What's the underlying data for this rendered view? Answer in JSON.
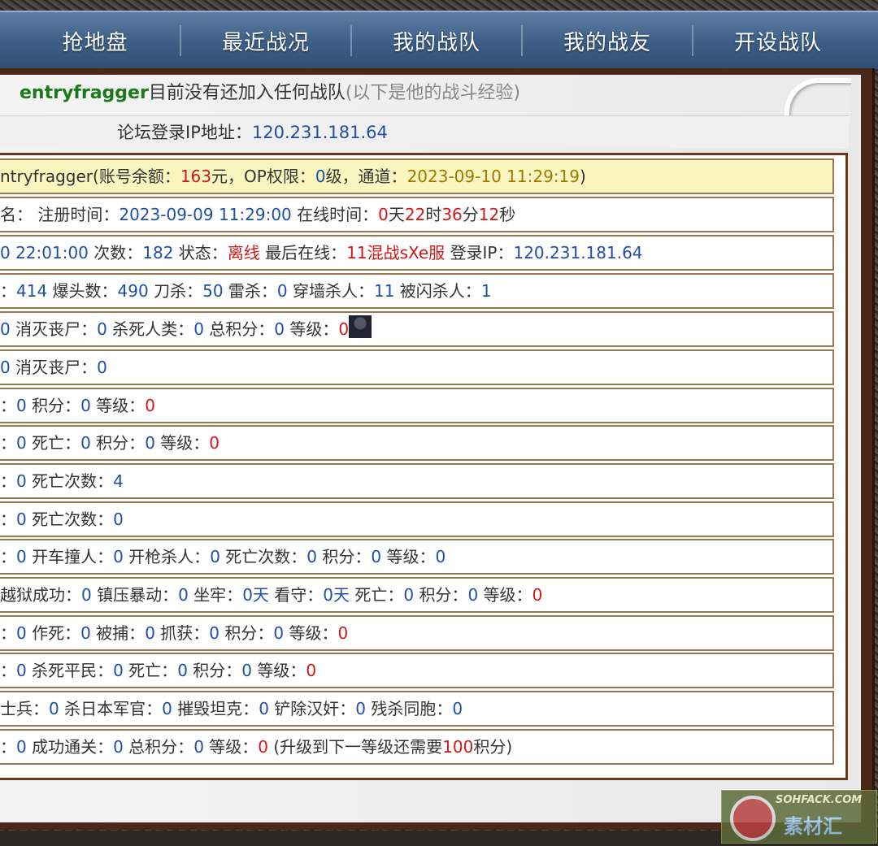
{
  "nav": {
    "items": [
      "抢地盘",
      "最近战况",
      "我的战队",
      "我的战友",
      "开设战队"
    ]
  },
  "header": {
    "username": "entryfragger",
    "no_team_text": "目前没有还加入任何战队",
    "note": "(以下是他的战斗经验)"
  },
  "ip_line": {
    "label": "论坛登录IP地址：",
    "value": "120.231.181.64"
  },
  "rows": [
    {
      "parts": [
        [
          "ntryfragger(账号余额：",
          ""
        ],
        [
          "163",
          "red"
        ],
        [
          "元，OP权限：",
          ""
        ],
        [
          "0",
          "blue"
        ],
        [
          "级，通道：",
          ""
        ],
        [
          "2023-09-10 11:29:19",
          "gold"
        ],
        [
          ")",
          ""
        ]
      ]
    },
    {
      "parts": [
        [
          "名： 注册时间：",
          ""
        ],
        [
          "2023-09-09 11:29:00",
          "blue"
        ],
        [
          " 在线时间：",
          ""
        ],
        [
          "0",
          "red"
        ],
        [
          "天",
          ""
        ],
        [
          "22",
          "red"
        ],
        [
          "时",
          ""
        ],
        [
          "36",
          "red"
        ],
        [
          "分",
          ""
        ],
        [
          "12",
          "red"
        ],
        [
          "秒",
          ""
        ]
      ]
    },
    {
      "parts": [
        [
          "0 22:01:00",
          "blue"
        ],
        [
          " 次数：",
          ""
        ],
        [
          "182",
          "blue"
        ],
        [
          " 状态：",
          ""
        ],
        [
          "离线",
          "red"
        ],
        [
          " 最后在线：",
          ""
        ],
        [
          "11混战sXe服",
          "red"
        ],
        [
          " 登录IP：",
          ""
        ],
        [
          "120.231.181.64",
          "blue"
        ]
      ]
    },
    {
      "parts": [
        [
          "：",
          ""
        ],
        [
          "414",
          "blue"
        ],
        [
          " 爆头数：",
          ""
        ],
        [
          "490",
          "blue"
        ],
        [
          " 刀杀：",
          ""
        ],
        [
          "50",
          "blue"
        ],
        [
          " 雷杀：",
          ""
        ],
        [
          "0",
          "blue"
        ],
        [
          " 穿墙杀人：",
          ""
        ],
        [
          "11",
          "blue"
        ],
        [
          " 被闪杀人：",
          ""
        ],
        [
          "1",
          "blue"
        ]
      ]
    },
    {
      "parts": [
        [
          "0",
          "blue"
        ],
        [
          " 消灭丧尸：",
          ""
        ],
        [
          "0",
          "blue"
        ],
        [
          " 杀死人类：",
          ""
        ],
        [
          "0",
          "blue"
        ],
        [
          " 总积分：",
          ""
        ],
        [
          "0",
          "blue"
        ],
        [
          " 等级：",
          ""
        ],
        [
          "0",
          "red"
        ]
      ],
      "avatar": true
    },
    {
      "parts": [
        [
          "0",
          "blue"
        ],
        [
          " 消灭丧尸：",
          ""
        ],
        [
          "0",
          "blue"
        ]
      ]
    },
    {
      "parts": [
        [
          "：",
          ""
        ],
        [
          "0",
          "blue"
        ],
        [
          " 积分：",
          ""
        ],
        [
          "0",
          "blue"
        ],
        [
          " 等级：",
          ""
        ],
        [
          "0",
          "red"
        ]
      ]
    },
    {
      "parts": [
        [
          "：",
          ""
        ],
        [
          "0",
          "blue"
        ],
        [
          " 死亡：",
          ""
        ],
        [
          "0",
          "blue"
        ],
        [
          " 积分：",
          ""
        ],
        [
          "0",
          "blue"
        ],
        [
          " 等级：",
          ""
        ],
        [
          "0",
          "red"
        ]
      ]
    },
    {
      "parts": [
        [
          "：",
          ""
        ],
        [
          "0",
          "blue"
        ],
        [
          " 死亡次数：",
          ""
        ],
        [
          "4",
          "blue"
        ]
      ]
    },
    {
      "parts": [
        [
          "：",
          ""
        ],
        [
          "0",
          "blue"
        ],
        [
          " 死亡次数：",
          ""
        ],
        [
          "0",
          "blue"
        ]
      ]
    },
    {
      "parts": [
        [
          "：",
          ""
        ],
        [
          "0",
          "blue"
        ],
        [
          " 开车撞人：",
          ""
        ],
        [
          "0",
          "blue"
        ],
        [
          " 开枪杀人：",
          ""
        ],
        [
          "0",
          "blue"
        ],
        [
          " 死亡次数：",
          ""
        ],
        [
          "0",
          "blue"
        ],
        [
          " 积分：",
          ""
        ],
        [
          "0",
          "blue"
        ],
        [
          " 等级：",
          ""
        ],
        [
          "0",
          "blue"
        ]
      ]
    },
    {
      "parts": [
        [
          "越狱成功：",
          ""
        ],
        [
          "0",
          "blue"
        ],
        [
          " 镇压暴动：",
          ""
        ],
        [
          "0",
          "blue"
        ],
        [
          " 坐牢：",
          ""
        ],
        [
          "0天",
          "blue"
        ],
        [
          " 看守：",
          ""
        ],
        [
          "0天",
          "blue"
        ],
        [
          " 死亡：",
          ""
        ],
        [
          "0",
          "blue"
        ],
        [
          " 积分：",
          ""
        ],
        [
          "0",
          "blue"
        ],
        [
          " 等级：",
          ""
        ],
        [
          "0",
          "red"
        ]
      ]
    },
    {
      "parts": [
        [
          "：",
          ""
        ],
        [
          "0",
          "blue"
        ],
        [
          " 作死：",
          ""
        ],
        [
          "0",
          "blue"
        ],
        [
          " 被捕：",
          ""
        ],
        [
          "0",
          "blue"
        ],
        [
          " 抓获：",
          ""
        ],
        [
          "0",
          "blue"
        ],
        [
          " 积分：",
          ""
        ],
        [
          "0",
          "blue"
        ],
        [
          " 等级：",
          ""
        ],
        [
          "0",
          "red"
        ]
      ]
    },
    {
      "parts": [
        [
          "：",
          ""
        ],
        [
          "0",
          "blue"
        ],
        [
          " 杀死平民：",
          ""
        ],
        [
          "0",
          "blue"
        ],
        [
          " 死亡：",
          ""
        ],
        [
          "0",
          "blue"
        ],
        [
          " 积分：",
          ""
        ],
        [
          "0",
          "blue"
        ],
        [
          " 等级：",
          ""
        ],
        [
          "0",
          "red"
        ]
      ]
    },
    {
      "parts": [
        [
          "士兵：",
          ""
        ],
        [
          "0",
          "blue"
        ],
        [
          " 杀日本军官：",
          ""
        ],
        [
          "0",
          "blue"
        ],
        [
          " 摧毁坦克：",
          ""
        ],
        [
          "0",
          "blue"
        ],
        [
          " 铲除汉奸：",
          ""
        ],
        [
          "0",
          "blue"
        ],
        [
          " 残杀同胞：",
          ""
        ],
        [
          "0",
          "blue"
        ]
      ]
    },
    {
      "parts": [
        [
          "：",
          ""
        ],
        [
          "0",
          "blue"
        ],
        [
          " 成功通关：",
          ""
        ],
        [
          "0",
          "blue"
        ],
        [
          " 总积分：",
          ""
        ],
        [
          "0",
          "blue"
        ],
        [
          " 等级：",
          ""
        ],
        [
          "0",
          "red"
        ],
        [
          " (升级到下一等级还需要",
          ""
        ],
        [
          "100",
          "red"
        ],
        [
          "积分)",
          ""
        ]
      ]
    }
  ],
  "watermark": {
    "line1": "SOHFACK.COM",
    "line2": "素材汇"
  }
}
